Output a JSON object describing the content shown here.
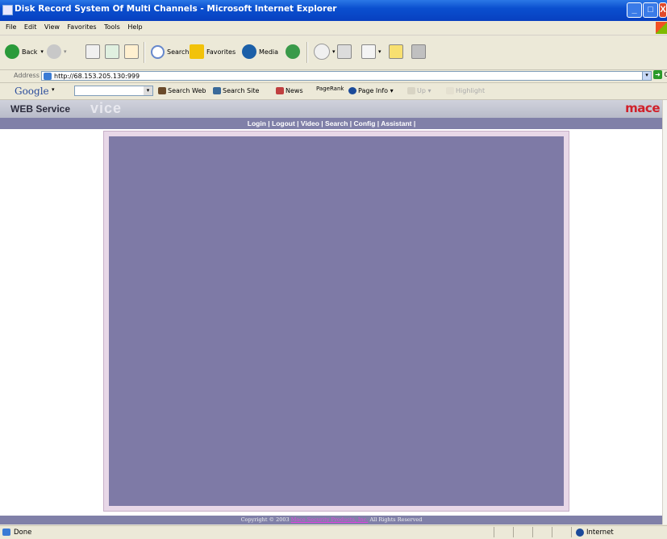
{
  "window": {
    "title": "Disk Record System Of Multi Channels - Microsoft Internet Explorer",
    "minimize": "_",
    "maximize": "□",
    "close": "X"
  },
  "menu": [
    "File",
    "Edit",
    "View",
    "Favorites",
    "Tools",
    "Help"
  ],
  "toolbar": {
    "back_label": "Back",
    "search_label": "Search",
    "favorites_label": "Favorites",
    "media_label": "Media"
  },
  "address": {
    "label": "Address",
    "url": "http://68.153.205.130:999",
    "go_label": "Go"
  },
  "google_bar": {
    "logo": "Google",
    "search_web": "Search Web",
    "search_site": "Search Site",
    "news": "News",
    "pagerank": "PageRank",
    "page_info": "Page Info",
    "up": "Up",
    "highlight": "Highlight"
  },
  "page": {
    "header_title": "WEB Service",
    "header_ghost": "vice",
    "brand": "mace",
    "nav": [
      "Login",
      "Logout",
      "Video",
      "Search",
      "Config",
      "Assistant"
    ],
    "footer_prefix": "Copyright © 2003",
    "footer_company": "Mace Security Products, Inc.",
    "footer_suffix": "All Rights Reserved"
  },
  "status": {
    "text": "Done",
    "zone": "Internet"
  },
  "colors": {
    "titlebar": "#0a4fcf",
    "navbar": "#8080a8",
    "video_area": "#7e7aa6",
    "brand_red": "#d0202a"
  }
}
